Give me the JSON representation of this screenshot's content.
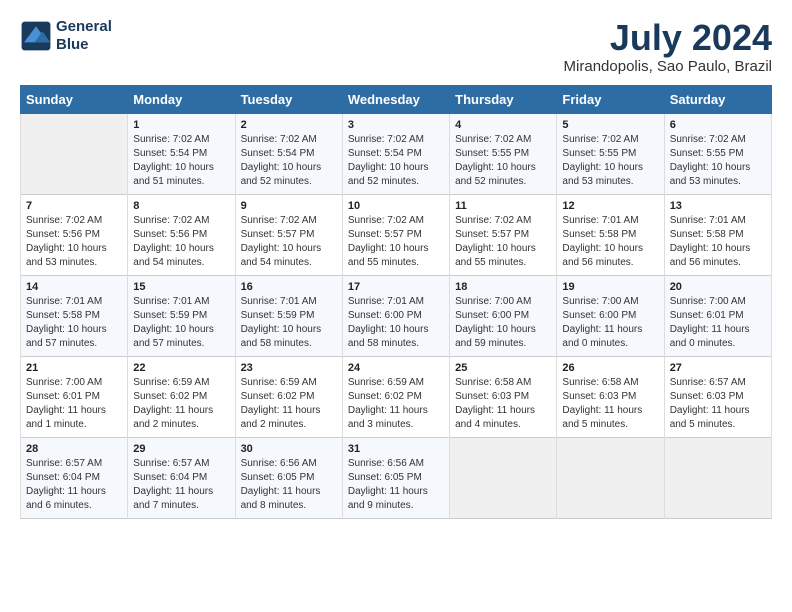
{
  "header": {
    "logo_line1": "General",
    "logo_line2": "Blue",
    "title": "July 2024",
    "subtitle": "Mirandopolis, Sao Paulo, Brazil"
  },
  "weekdays": [
    "Sunday",
    "Monday",
    "Tuesday",
    "Wednesday",
    "Thursday",
    "Friday",
    "Saturday"
  ],
  "weeks": [
    [
      {
        "num": "",
        "empty": true
      },
      {
        "num": "1",
        "sunrise": "7:02 AM",
        "sunset": "5:54 PM",
        "daylight": "10 hours and 51 minutes."
      },
      {
        "num": "2",
        "sunrise": "7:02 AM",
        "sunset": "5:54 PM",
        "daylight": "10 hours and 52 minutes."
      },
      {
        "num": "3",
        "sunrise": "7:02 AM",
        "sunset": "5:54 PM",
        "daylight": "10 hours and 52 minutes."
      },
      {
        "num": "4",
        "sunrise": "7:02 AM",
        "sunset": "5:55 PM",
        "daylight": "10 hours and 52 minutes."
      },
      {
        "num": "5",
        "sunrise": "7:02 AM",
        "sunset": "5:55 PM",
        "daylight": "10 hours and 53 minutes."
      },
      {
        "num": "6",
        "sunrise": "7:02 AM",
        "sunset": "5:55 PM",
        "daylight": "10 hours and 53 minutes."
      }
    ],
    [
      {
        "num": "7",
        "sunrise": "7:02 AM",
        "sunset": "5:56 PM",
        "daylight": "10 hours and 53 minutes."
      },
      {
        "num": "8",
        "sunrise": "7:02 AM",
        "sunset": "5:56 PM",
        "daylight": "10 hours and 54 minutes."
      },
      {
        "num": "9",
        "sunrise": "7:02 AM",
        "sunset": "5:57 PM",
        "daylight": "10 hours and 54 minutes."
      },
      {
        "num": "10",
        "sunrise": "7:02 AM",
        "sunset": "5:57 PM",
        "daylight": "10 hours and 55 minutes."
      },
      {
        "num": "11",
        "sunrise": "7:02 AM",
        "sunset": "5:57 PM",
        "daylight": "10 hours and 55 minutes."
      },
      {
        "num": "12",
        "sunrise": "7:01 AM",
        "sunset": "5:58 PM",
        "daylight": "10 hours and 56 minutes."
      },
      {
        "num": "13",
        "sunrise": "7:01 AM",
        "sunset": "5:58 PM",
        "daylight": "10 hours and 56 minutes."
      }
    ],
    [
      {
        "num": "14",
        "sunrise": "7:01 AM",
        "sunset": "5:58 PM",
        "daylight": "10 hours and 57 minutes."
      },
      {
        "num": "15",
        "sunrise": "7:01 AM",
        "sunset": "5:59 PM",
        "daylight": "10 hours and 57 minutes."
      },
      {
        "num": "16",
        "sunrise": "7:01 AM",
        "sunset": "5:59 PM",
        "daylight": "10 hours and 58 minutes."
      },
      {
        "num": "17",
        "sunrise": "7:01 AM",
        "sunset": "6:00 PM",
        "daylight": "10 hours and 58 minutes."
      },
      {
        "num": "18",
        "sunrise": "7:00 AM",
        "sunset": "6:00 PM",
        "daylight": "10 hours and 59 minutes."
      },
      {
        "num": "19",
        "sunrise": "7:00 AM",
        "sunset": "6:00 PM",
        "daylight": "11 hours and 0 minutes."
      },
      {
        "num": "20",
        "sunrise": "7:00 AM",
        "sunset": "6:01 PM",
        "daylight": "11 hours and 0 minutes."
      }
    ],
    [
      {
        "num": "21",
        "sunrise": "7:00 AM",
        "sunset": "6:01 PM",
        "daylight": "11 hours and 1 minute."
      },
      {
        "num": "22",
        "sunrise": "6:59 AM",
        "sunset": "6:02 PM",
        "daylight": "11 hours and 2 minutes."
      },
      {
        "num": "23",
        "sunrise": "6:59 AM",
        "sunset": "6:02 PM",
        "daylight": "11 hours and 2 minutes."
      },
      {
        "num": "24",
        "sunrise": "6:59 AM",
        "sunset": "6:02 PM",
        "daylight": "11 hours and 3 minutes."
      },
      {
        "num": "25",
        "sunrise": "6:58 AM",
        "sunset": "6:03 PM",
        "daylight": "11 hours and 4 minutes."
      },
      {
        "num": "26",
        "sunrise": "6:58 AM",
        "sunset": "6:03 PM",
        "daylight": "11 hours and 5 minutes."
      },
      {
        "num": "27",
        "sunrise": "6:57 AM",
        "sunset": "6:03 PM",
        "daylight": "11 hours and 5 minutes."
      }
    ],
    [
      {
        "num": "28",
        "sunrise": "6:57 AM",
        "sunset": "6:04 PM",
        "daylight": "11 hours and 6 minutes."
      },
      {
        "num": "29",
        "sunrise": "6:57 AM",
        "sunset": "6:04 PM",
        "daylight": "11 hours and 7 minutes."
      },
      {
        "num": "30",
        "sunrise": "6:56 AM",
        "sunset": "6:05 PM",
        "daylight": "11 hours and 8 minutes."
      },
      {
        "num": "31",
        "sunrise": "6:56 AM",
        "sunset": "6:05 PM",
        "daylight": "11 hours and 9 minutes."
      },
      {
        "num": "",
        "empty": true
      },
      {
        "num": "",
        "empty": true
      },
      {
        "num": "",
        "empty": true
      }
    ]
  ]
}
